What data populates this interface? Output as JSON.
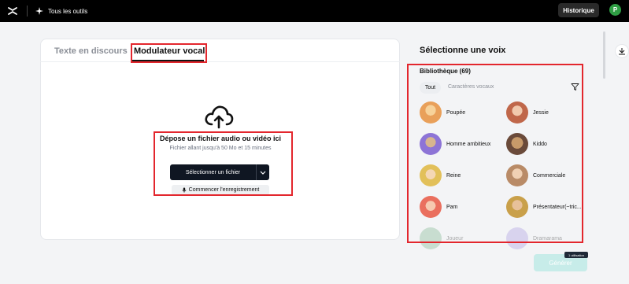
{
  "topbar": {
    "logo_icon": "capcut-logo-icon",
    "tools_icon": "sparkle-icon",
    "tools_label": "Tous les outils",
    "history_label": "Historique",
    "user_initial": "P"
  },
  "tabs": [
    {
      "label": "Texte en discours",
      "active": false
    },
    {
      "label": "Modulateur vocal",
      "active": true
    }
  ],
  "upload": {
    "icon": "cloud-upload-icon",
    "title": "Dépose un fichier audio ou vidéo ici",
    "subtitle": "Fichier allant jusqu'à 50 Mo et 15 minutes",
    "select_label": "Sélectionner un fichier",
    "record_icon": "microphone-icon",
    "record_label": "Commencer l'enregistrement"
  },
  "voices_panel": {
    "title": "Sélectionne une voix",
    "library_label": "Bibliothèque (69)",
    "filter_all": "Tout",
    "filter_voice": "Caractères vocaux",
    "voices": [
      {
        "name": "Poupée",
        "color": "#e9a05a"
      },
      {
        "name": "Jessie",
        "color": "#c0674a"
      },
      {
        "name": "Homme ambitieux",
        "color": "#8d74d6"
      },
      {
        "name": "Kiddo",
        "color": "#6a4a3a"
      },
      {
        "name": "Reine",
        "color": "#e2c05a"
      },
      {
        "name": "Commerciale",
        "color": "#b98b67"
      },
      {
        "name": "Pam",
        "color": "#ea6f5e"
      },
      {
        "name": "Présentateur(~tric...",
        "color": "#c9a04a"
      },
      {
        "name": "Joueur",
        "color": "#7ab58a"
      },
      {
        "name": "Dramarama",
        "color": "#a897e0"
      }
    ]
  },
  "footer": {
    "generate_label": "Générer",
    "credit_label": "1 utilisation"
  },
  "colors": {
    "highlight": "#e3262d",
    "accent": "#0f1622",
    "generate_disabled": "#c7ece9"
  }
}
